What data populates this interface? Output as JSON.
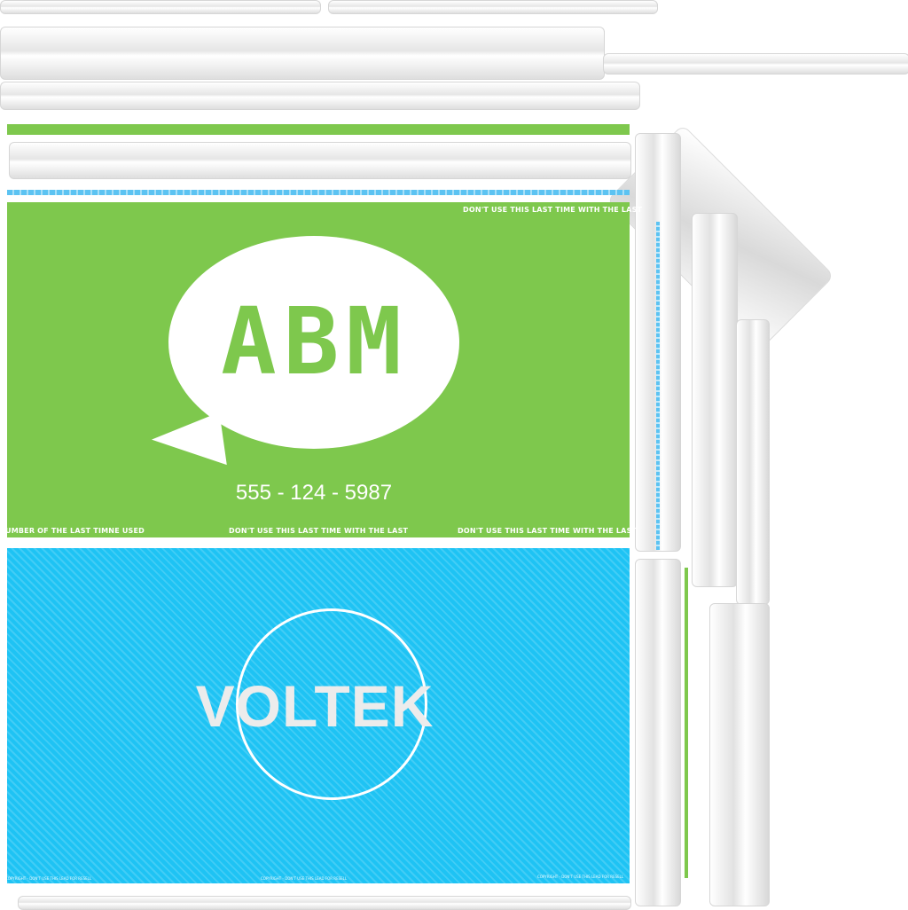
{
  "logo": {
    "text": "ABM"
  },
  "phone": "555 - 124 - 5987",
  "fine_print": {
    "top_right": "DON'T USE THIS LAST TIME WITH THE LAST",
    "bottom_left": "UMBER OF THE LAST TIMNE USED",
    "bottom_center": "DON'T USE THIS LAST TIME WITH THE LAST",
    "bottom_right": "DON'T USE THIS LAST TIME WITH THE LAST"
  },
  "voltek": {
    "text": "VOLTEK"
  },
  "copyright": {
    "left": "COPYRIGHT - DON'T USE THIS LEAD FOR RESELL",
    "center": "COPYRIGHT - DON'T USE THIS LEAD FOR RESELL",
    "right": "COPYRIGHT - DON'T USE THIS LEAD FOR RESELL"
  },
  "colors": {
    "green": "#7ec84d",
    "blue": "#1ec3f4",
    "white": "#ffffff"
  }
}
